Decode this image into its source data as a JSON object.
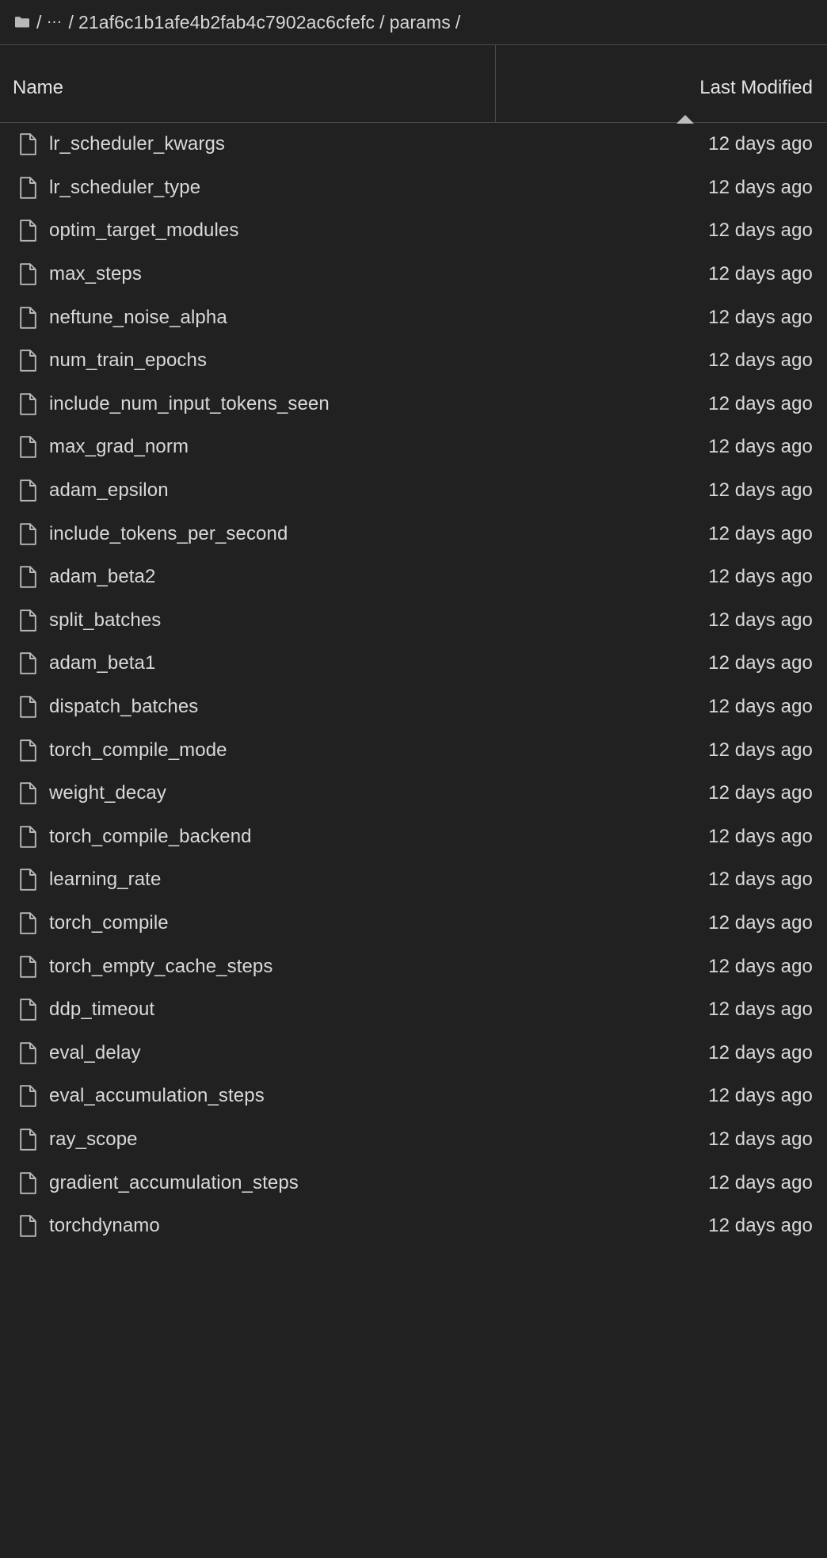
{
  "breadcrumb": {
    "home_icon": "folder-icon",
    "separator": "/",
    "ellipsis": "…",
    "segments": [
      {
        "label": "21af6c1b1afe4b2fab4c7902ac6cfefc"
      },
      {
        "label": "params"
      }
    ]
  },
  "header": {
    "name_label": "Name",
    "modified_label": "Last Modified",
    "sort_indicator": "caret-up-icon",
    "sort_direction": "ascending"
  },
  "colors": {
    "background": "#212121",
    "text": "#d9d9d9",
    "border": "#4a4a4a",
    "icon": "#b8b8b8"
  },
  "files": [
    {
      "icon": "file-icon",
      "name": "lr_scheduler_kwargs",
      "modified": "12 days ago"
    },
    {
      "icon": "file-icon",
      "name": "lr_scheduler_type",
      "modified": "12 days ago"
    },
    {
      "icon": "file-icon",
      "name": "optim_target_modules",
      "modified": "12 days ago"
    },
    {
      "icon": "file-icon",
      "name": "max_steps",
      "modified": "12 days ago"
    },
    {
      "icon": "file-icon",
      "name": "neftune_noise_alpha",
      "modified": "12 days ago"
    },
    {
      "icon": "file-icon",
      "name": "num_train_epochs",
      "modified": "12 days ago"
    },
    {
      "icon": "file-icon",
      "name": "include_num_input_tokens_seen",
      "modified": "12 days ago"
    },
    {
      "icon": "file-icon",
      "name": "max_grad_norm",
      "modified": "12 days ago"
    },
    {
      "icon": "file-icon",
      "name": "adam_epsilon",
      "modified": "12 days ago"
    },
    {
      "icon": "file-icon",
      "name": "include_tokens_per_second",
      "modified": "12 days ago"
    },
    {
      "icon": "file-icon",
      "name": "adam_beta2",
      "modified": "12 days ago"
    },
    {
      "icon": "file-icon",
      "name": "split_batches",
      "modified": "12 days ago"
    },
    {
      "icon": "file-icon",
      "name": "adam_beta1",
      "modified": "12 days ago"
    },
    {
      "icon": "file-icon",
      "name": "dispatch_batches",
      "modified": "12 days ago"
    },
    {
      "icon": "file-icon",
      "name": "torch_compile_mode",
      "modified": "12 days ago"
    },
    {
      "icon": "file-icon",
      "name": "weight_decay",
      "modified": "12 days ago"
    },
    {
      "icon": "file-icon",
      "name": "torch_compile_backend",
      "modified": "12 days ago"
    },
    {
      "icon": "file-icon",
      "name": "learning_rate",
      "modified": "12 days ago"
    },
    {
      "icon": "file-icon",
      "name": "torch_compile",
      "modified": "12 days ago"
    },
    {
      "icon": "file-icon",
      "name": "torch_empty_cache_steps",
      "modified": "12 days ago"
    },
    {
      "icon": "file-icon",
      "name": "ddp_timeout",
      "modified": "12 days ago"
    },
    {
      "icon": "file-icon",
      "name": "eval_delay",
      "modified": "12 days ago"
    },
    {
      "icon": "file-icon",
      "name": "eval_accumulation_steps",
      "modified": "12 days ago"
    },
    {
      "icon": "file-icon",
      "name": "ray_scope",
      "modified": "12 days ago"
    },
    {
      "icon": "file-icon",
      "name": "gradient_accumulation_steps",
      "modified": "12 days ago"
    },
    {
      "icon": "file-icon",
      "name": "torchdynamo",
      "modified": "12 days ago"
    }
  ]
}
